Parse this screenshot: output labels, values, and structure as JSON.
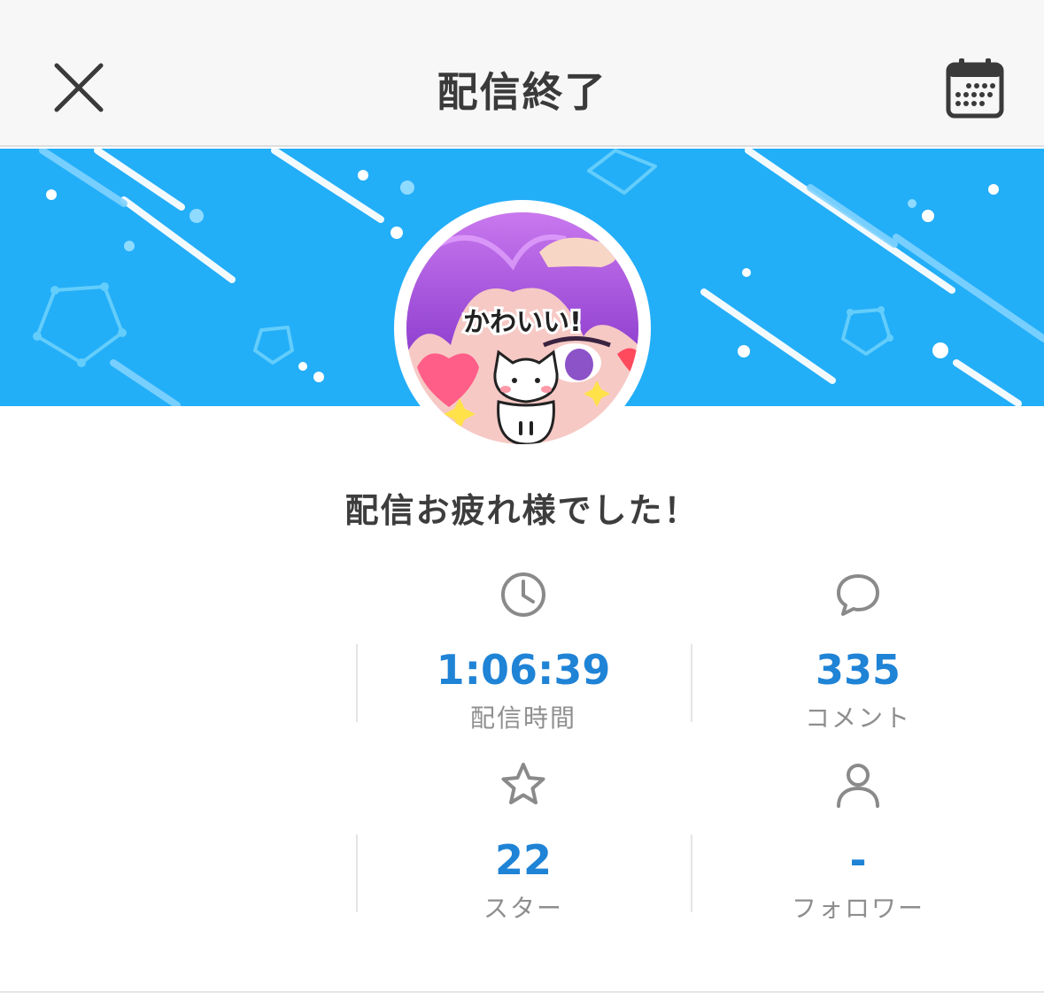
{
  "header": {
    "title": "配信終了",
    "close_icon": "close-icon",
    "calendar_icon": "calendar-icon"
  },
  "banner": {
    "color": "#23aef8",
    "avatar_caption": "かわいい!"
  },
  "message": "配信お疲れ様でした！",
  "stats": {
    "duration": {
      "icon": "clock-icon",
      "value": "1:06:39",
      "label": "配信時間"
    },
    "comments": {
      "icon": "comment-bubble-icon",
      "value": "335",
      "label": "コメント"
    },
    "stars": {
      "icon": "star-icon",
      "value": "22",
      "label": "スター"
    },
    "followers": {
      "icon": "user-icon",
      "value": "-",
      "label": "フォロワー"
    }
  },
  "colors": {
    "accent": "#1f83d6",
    "banner": "#23aef8",
    "text": "#3a3a3a",
    "muted": "#8e8e8e"
  }
}
